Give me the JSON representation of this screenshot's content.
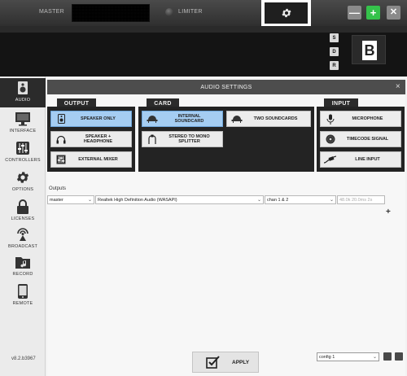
{
  "topbar": {
    "master_label": "MASTER",
    "limiter_label": "LIMITER",
    "minimize_label": "—",
    "maximize_label": "+",
    "close_label": "✕",
    "settings_icon": "gear-icon"
  },
  "deck": {
    "sdr": [
      "S",
      "D",
      "R"
    ],
    "deck_label": "B"
  },
  "sidebar": {
    "items": [
      {
        "label": "AUDIO",
        "icon": "speaker-icon",
        "active": true
      },
      {
        "label": "INTERFACE",
        "icon": "monitor-icon"
      },
      {
        "label": "CONTROLLERS",
        "icon": "sliders-icon"
      },
      {
        "label": "OPTIONS",
        "icon": "gear-icon"
      },
      {
        "label": "LICENSES",
        "icon": "lock-icon"
      },
      {
        "label": "BROADCAST",
        "icon": "broadcast-icon"
      },
      {
        "label": "RECORD",
        "icon": "music-folder-icon"
      },
      {
        "label": "REMOTE",
        "icon": "phone-icon"
      }
    ],
    "version": "v8.2.b3967"
  },
  "panel": {
    "title": "AUDIO SETTINGS",
    "close": "×",
    "groups": {
      "output": {
        "title": "OUTPUT",
        "options": [
          {
            "label": "SPEAKER ONLY",
            "icon": "speaker-icon",
            "selected": true
          },
          {
            "label": "SPEAKER +\nHEADPHONE",
            "icon": "headphone-icon"
          },
          {
            "label": "EXTERNAL MIXER",
            "icon": "mixer-icon"
          }
        ]
      },
      "card": {
        "title": "CARD",
        "options": [
          {
            "label": "INTERNAL\nSOUNDCARD",
            "icon": "soundcard-icon",
            "selected": true
          },
          {
            "label": "STEREO TO MONO\nSPLITTER",
            "icon": "splitter-icon"
          },
          {
            "label": "TWO SOUNDCARDS",
            "icon": "soundcard-icon"
          }
        ]
      },
      "input": {
        "title": "INPUT",
        "options": [
          {
            "label": "MICROPHONE",
            "icon": "microphone-icon"
          },
          {
            "label": "TIMECODE SIGNAL",
            "icon": "vinyl-icon"
          },
          {
            "label": "LINE INPUT",
            "icon": "plug-icon"
          }
        ]
      }
    },
    "outputs_label": "Outputs",
    "outputs_row": {
      "channel": "master",
      "device": "Realtek High Definition Audio (WASAPI)",
      "chan": "chan 1 & 2",
      "format": "48.0k 20.0ms 2s"
    },
    "add_label": "+",
    "apply_label": "APPLY",
    "config_value": "config 1"
  },
  "colors": {
    "selected": "#a5cdf2",
    "maximize_green": "#35c24b",
    "group_bg": "#232323"
  }
}
